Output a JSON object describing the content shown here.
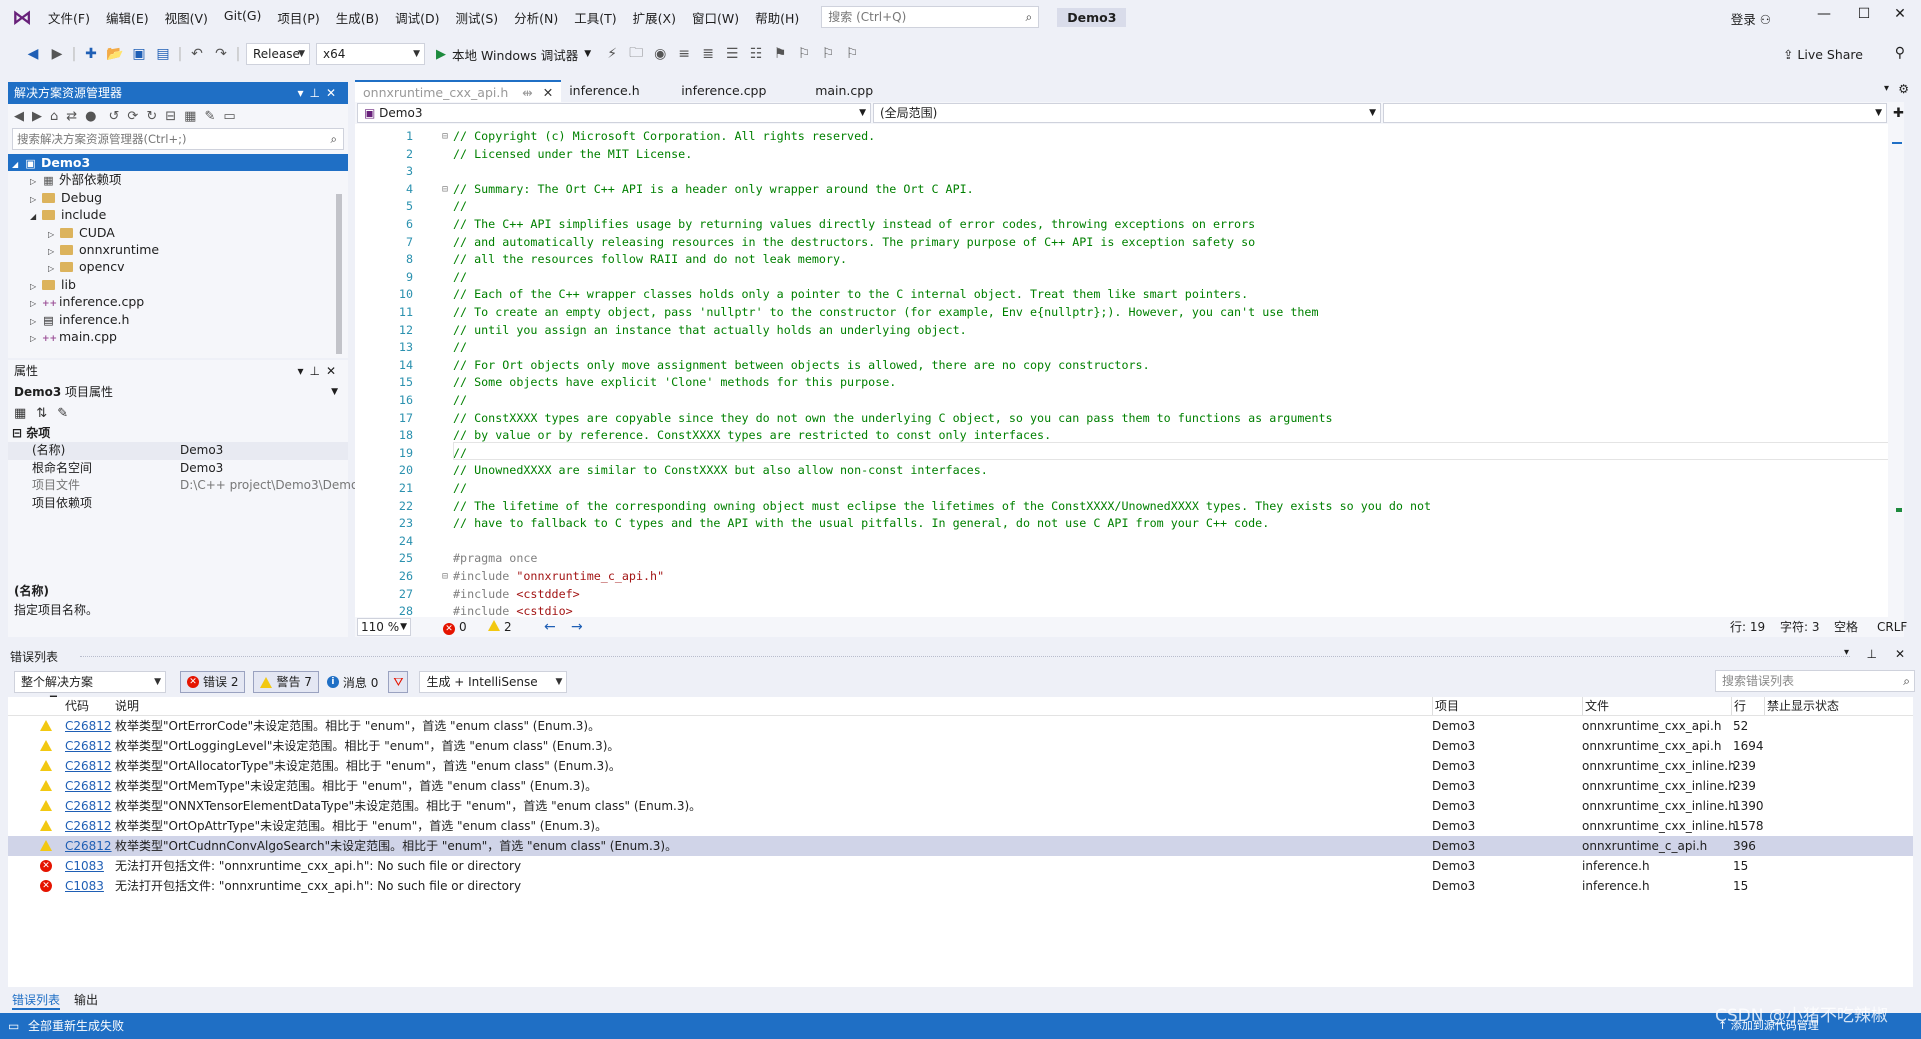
{
  "menubar": {
    "items": [
      "文件(F)",
      "编辑(E)",
      "视图(V)",
      "Git(G)",
      "项目(P)",
      "生成(B)",
      "调试(D)",
      "测试(S)",
      "分析(N)",
      "工具(T)",
      "扩展(X)",
      "窗口(W)",
      "帮助(H)"
    ],
    "search_placeholder": "搜索 (Ctrl+Q)",
    "solution_name": "Demo3",
    "login": "登录"
  },
  "toolbar": {
    "config": "Release",
    "platform": "x64",
    "run_label": "本地 Windows 调试器",
    "live_share": "Live Share"
  },
  "solution_explorer": {
    "title": "解决方案资源管理器",
    "search_placeholder": "搜索解决方案资源管理器(Ctrl+;)",
    "items": [
      {
        "label": "Demo3"
      },
      {
        "label": "外部依赖项"
      },
      {
        "label": "Debug"
      },
      {
        "label": "include"
      },
      {
        "label": "CUDA"
      },
      {
        "label": "onnxruntime"
      },
      {
        "label": "opencv"
      },
      {
        "label": "lib"
      },
      {
        "label": "inference.cpp"
      },
      {
        "label": "inference.h"
      },
      {
        "label": "main.cpp"
      }
    ]
  },
  "properties": {
    "title": "属性",
    "object": "Demo3",
    "object_type": "项目属性",
    "category": "杂项",
    "rows": [
      {
        "key": "(名称)",
        "value": "Demo3"
      },
      {
        "key": "根命名空间",
        "value": "Demo3"
      },
      {
        "key": "项目文件",
        "value": "D:\\C++ project\\Demo3\\Demo"
      },
      {
        "key": "项目依赖项",
        "value": ""
      }
    ],
    "desc_title": "(名称)",
    "desc_text": "指定项目名称。"
  },
  "editor": {
    "tabs": [
      "onnxruntime_cxx_api.h",
      "inference.h",
      "inference.cpp",
      "main.cpp"
    ],
    "pin_glyph": "⇹",
    "nav_project": "Demo3",
    "nav_scope": "(全局范围)",
    "nav_member": "",
    "lines": [
      {
        "n": "1",
        "fold": "⊟",
        "t": "// Copyright (c) Microsoft Corporation. All rights reserved.",
        "k": "cm"
      },
      {
        "n": "2",
        "fold": "",
        "t": "// Licensed under the MIT License.",
        "k": "cm"
      },
      {
        "n": "3",
        "fold": "",
        "t": "",
        "k": "cm"
      },
      {
        "n": "4",
        "fold": "⊟",
        "t": "// Summary: The Ort C++ API is a header only wrapper around the Ort C API.",
        "k": "cm"
      },
      {
        "n": "5",
        "fold": "",
        "t": "//",
        "k": "cm"
      },
      {
        "n": "6",
        "fold": "",
        "t": "// The C++ API simplifies usage by returning values directly instead of error codes, throwing exceptions on errors",
        "k": "cm"
      },
      {
        "n": "7",
        "fold": "",
        "t": "// and automatically releasing resources in the destructors. The primary purpose of C++ API is exception safety so",
        "k": "cm"
      },
      {
        "n": "8",
        "fold": "",
        "t": "// all the resources follow RAII and do not leak memory.",
        "k": "cm"
      },
      {
        "n": "9",
        "fold": "",
        "t": "//",
        "k": "cm"
      },
      {
        "n": "10",
        "fold": "",
        "t": "// Each of the C++ wrapper classes holds only a pointer to the C internal object. Treat them like smart pointers.",
        "k": "cm"
      },
      {
        "n": "11",
        "fold": "",
        "t": "// To create an empty object, pass 'nullptr' to the constructor (for example, Env e{nullptr};). However, you can't use them",
        "k": "cm"
      },
      {
        "n": "12",
        "fold": "",
        "t": "// until you assign an instance that actually holds an underlying object.",
        "k": "cm"
      },
      {
        "n": "13",
        "fold": "",
        "t": "//",
        "k": "cm"
      },
      {
        "n": "14",
        "fold": "",
        "t": "// For Ort objects only move assignment between objects is allowed, there are no copy constructors.",
        "k": "cm"
      },
      {
        "n": "15",
        "fold": "",
        "t": "// Some objects have explicit 'Clone' methods for this purpose.",
        "k": "cm"
      },
      {
        "n": "16",
        "fold": "",
        "t": "//",
        "k": "cm"
      },
      {
        "n": "17",
        "fold": "",
        "t": "// ConstXXXX types are copyable since they do not own the underlying C object, so you can pass them to functions as arguments",
        "k": "cm"
      },
      {
        "n": "18",
        "fold": "",
        "t": "// by value or by reference. ConstXXXX types are restricted to const only interfaces.",
        "k": "cm"
      },
      {
        "n": "19",
        "fold": "",
        "t": "//",
        "k": "cm"
      },
      {
        "n": "20",
        "fold": "",
        "t": "// UnownedXXXX are similar to ConstXXXX but also allow non-const interfaces.",
        "k": "cm"
      },
      {
        "n": "21",
        "fold": "",
        "t": "//",
        "k": "cm"
      },
      {
        "n": "22",
        "fold": "",
        "t": "// The lifetime of the corresponding owning object must eclipse the lifetimes of the ConstXXXX/UnownedXXXX types. They exists so you do not",
        "k": "cm"
      },
      {
        "n": "23",
        "fold": "",
        "t": "// have to fallback to C types and the API with the usual pitfalls. In general, do not use C API from your C++ code.",
        "k": "cm"
      },
      {
        "n": "24",
        "fold": "",
        "t": "",
        "k": "cm"
      },
      {
        "n": "25",
        "fold": "",
        "t": "#pragma once",
        "k": "pp"
      },
      {
        "n": "26",
        "fold": "⊟",
        "t": "#include ",
        "k": "pp",
        "s": "\"onnxruntime_c_api.h\""
      },
      {
        "n": "27",
        "fold": "",
        "t": "#include ",
        "k": "pp",
        "s": "<cstddef>"
      },
      {
        "n": "28",
        "fold": "",
        "t": "#include ",
        "k": "pp",
        "s": "<cstdio>"
      }
    ],
    "status": {
      "zoom": "110 %",
      "errors": "0",
      "warnings": "2",
      "line": "行: 19",
      "col": "字符: 3",
      "ws": "空格",
      "eol": "CRLF"
    }
  },
  "error_list": {
    "title": "错误列表",
    "scope": "整个解决方案",
    "errors_btn": "错误 2",
    "warnings_btn": "警告 7",
    "messages_btn": "消息 0",
    "build_filter": "生成 + IntelliSense",
    "search_placeholder": "搜索错误列表",
    "columns": [
      "代码",
      "说明",
      "项目",
      "文件",
      "行",
      "禁止显示状态"
    ],
    "rows": [
      {
        "type": "warning",
        "code": "C26812",
        "desc": "枚举类型\"OrtErrorCode\"未设定范围。相比于 \"enum\"，首选 \"enum class\" (Enum.3)。",
        "project": "Demo3",
        "file": "onnxruntime_cxx_api.h",
        "line": "52"
      },
      {
        "type": "warning",
        "code": "C26812",
        "desc": "枚举类型\"OrtLoggingLevel\"未设定范围。相比于 \"enum\"，首选 \"enum class\" (Enum.3)。",
        "project": "Demo3",
        "file": "onnxruntime_cxx_api.h",
        "line": "1694"
      },
      {
        "type": "warning",
        "code": "C26812",
        "desc": "枚举类型\"OrtAllocatorType\"未设定范围。相比于 \"enum\"，首选 \"enum class\" (Enum.3)。",
        "project": "Demo3",
        "file": "onnxruntime_cxx_inline.h",
        "line": "239"
      },
      {
        "type": "warning",
        "code": "C26812",
        "desc": "枚举类型\"OrtMemType\"未设定范围。相比于 \"enum\"，首选 \"enum class\" (Enum.3)。",
        "project": "Demo3",
        "file": "onnxruntime_cxx_inline.h",
        "line": "239"
      },
      {
        "type": "warning",
        "code": "C26812",
        "desc": "枚举类型\"ONNXTensorElementDataType\"未设定范围。相比于 \"enum\"，首选 \"enum class\" (Enum.3)。",
        "project": "Demo3",
        "file": "onnxruntime_cxx_inline.h",
        "line": "1390"
      },
      {
        "type": "warning",
        "code": "C26812",
        "desc": "枚举类型\"OrtOpAttrType\"未设定范围。相比于 \"enum\"，首选 \"enum class\" (Enum.3)。",
        "project": "Demo3",
        "file": "onnxruntime_cxx_inline.h",
        "line": "1578"
      },
      {
        "type": "warning",
        "code": "C26812",
        "desc": "枚举类型\"OrtCudnnConvAlgoSearch\"未设定范围。相比于 \"enum\"，首选 \"enum class\" (Enum.3)。",
        "project": "Demo3",
        "file": "onnxruntime_c_api.h",
        "line": "396"
      },
      {
        "type": "error",
        "code": "C1083",
        "desc": "无法打开包括文件: \"onnxruntime_cxx_api.h\": No such file or directory",
        "project": "Demo3",
        "file": "inference.h",
        "line": "15"
      },
      {
        "type": "error",
        "code": "C1083",
        "desc": "无法打开包括文件: \"onnxruntime_cxx_api.h\": No such file or directory",
        "project": "Demo3",
        "file": "inference.h",
        "line": "15"
      }
    ]
  },
  "bottom_tabs": [
    "错误列表",
    "输出"
  ],
  "statusbar": {
    "message": "全部重新生成失败",
    "add_source": "添加到源代码管理",
    "watermark": "CSDN @小猪不吃辣椒"
  },
  "colors": {
    "accent": "#1f6fc5",
    "error": "#e51400",
    "warning": "#f2c811",
    "comment": "#008000",
    "string": "#a31515"
  }
}
